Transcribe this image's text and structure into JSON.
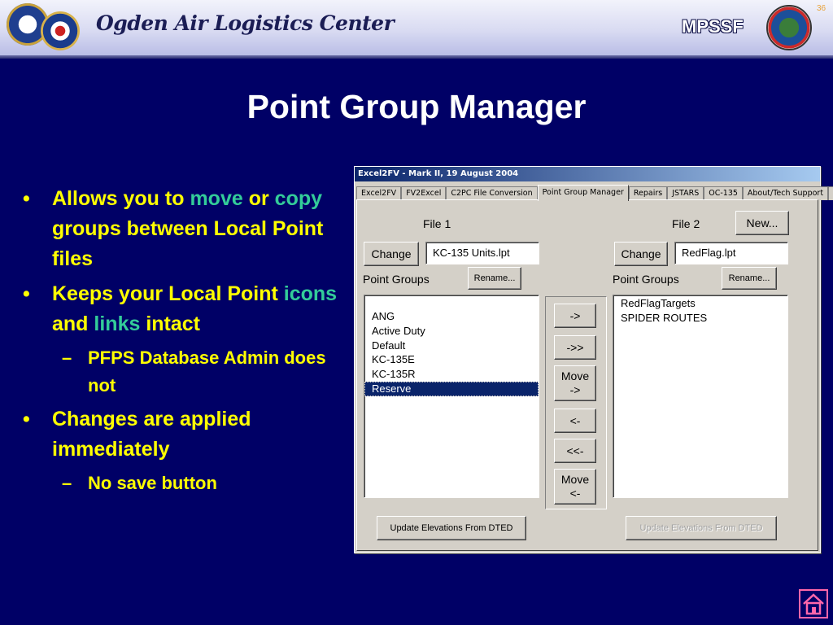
{
  "header": {
    "org_name": "Ogden Air Logistics Center",
    "program": "MPSSF",
    "slide_number": "36",
    "home_icon": "home-icon"
  },
  "slide": {
    "title": "Point Group Manager",
    "bullets": [
      {
        "parts": [
          "Allows you to ",
          "move",
          " or ",
          "copy",
          " groups between Local Point files"
        ]
      },
      {
        "parts": [
          "Keeps your Local Point ",
          "icons",
          " and ",
          "links",
          " intact"
        ]
      },
      {
        "sub": "PFPS Database Admin does not"
      },
      {
        "text": "Changes are applied immediately"
      },
      {
        "sub": "No save button"
      }
    ],
    "colors": {
      "background": "#000066",
      "bullet_text": "#ffff00",
      "highlight": "#33cc99",
      "title": "#ffffff"
    }
  },
  "dialog": {
    "title": "Excel2FV - Mark II,  19 August 2004",
    "tabs": [
      "Excel2FV",
      "FV2Excel",
      "C2PC File Conversion",
      "Point Group Manager",
      "Repairs",
      "JSTARS",
      "OC-135",
      "About/Tech Support",
      "V"
    ],
    "active_tab": "Point Group Manager",
    "left": {
      "file_label": "File 1",
      "change_label": "Change",
      "file_value": "KC-135 Units.lpt",
      "groups_label": "Point Groups",
      "rename_label": "Rename...",
      "items": [
        "ANG",
        "Active Duty",
        "Default",
        "KC-135E",
        "KC-135R",
        "Reserve"
      ],
      "selected": "Reserve",
      "update_label": "Update Elevations From DTED"
    },
    "right": {
      "file_label": "File 2",
      "new_label": "New...",
      "change_label": "Change",
      "file_value": "RedFlag.lpt",
      "groups_label": "Point Groups",
      "rename_label": "Rename...",
      "items": [
        "RedFlagTargets",
        "SPIDER ROUTES"
      ],
      "update_label": "Update Elevations From DTED",
      "update_disabled": true
    },
    "transfer_buttons": {
      "copy_one": "->",
      "copy_all": "->>",
      "move_right_1": "Move",
      "move_right_2": "->",
      "back_one": "<-",
      "back_all": "<<-",
      "move_left_1": "Move",
      "move_left_2": "<-"
    }
  }
}
